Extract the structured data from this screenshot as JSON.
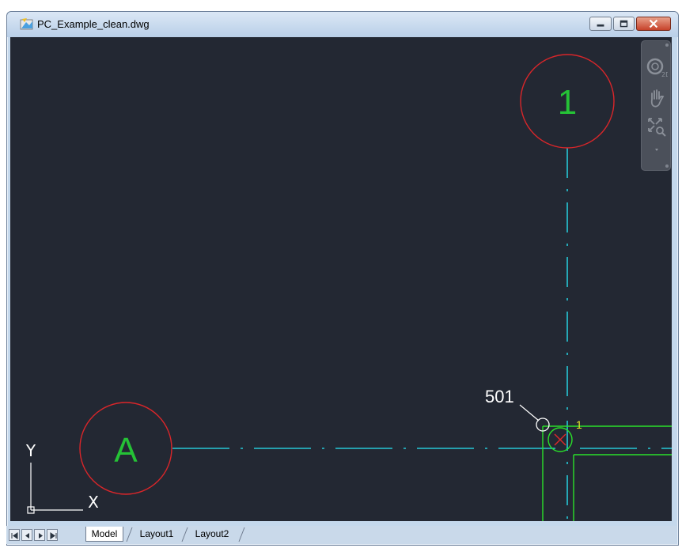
{
  "window": {
    "title": "PC_Example_clean.dwg"
  },
  "canvas": {
    "background": "#232833",
    "grid_bubbles": [
      {
        "label": "1",
        "circle_color": "#d9262a",
        "text_color": "#25c236"
      },
      {
        "label": "A",
        "circle_color": "#d9262a",
        "text_color": "#25c236"
      }
    ],
    "annotation": {
      "text": "501"
    },
    "small_label": "1",
    "axis_labels": {
      "x": "X",
      "y": "Y"
    },
    "colors": {
      "centerline": "#26c8d8",
      "wall": "#2ae02a",
      "marker": "#e02a2a",
      "annotation": "#ffffff",
      "small_label": "#e6e62a"
    }
  },
  "navigation_bar": {
    "items": [
      "zoom-2d-icon",
      "pan-hand-icon",
      "zoom-extents-icon",
      "more-dropdown-icon"
    ]
  },
  "tabs": [
    {
      "label": "Model",
      "active": true
    },
    {
      "label": "Layout1",
      "active": false
    },
    {
      "label": "Layout2",
      "active": false
    }
  ]
}
